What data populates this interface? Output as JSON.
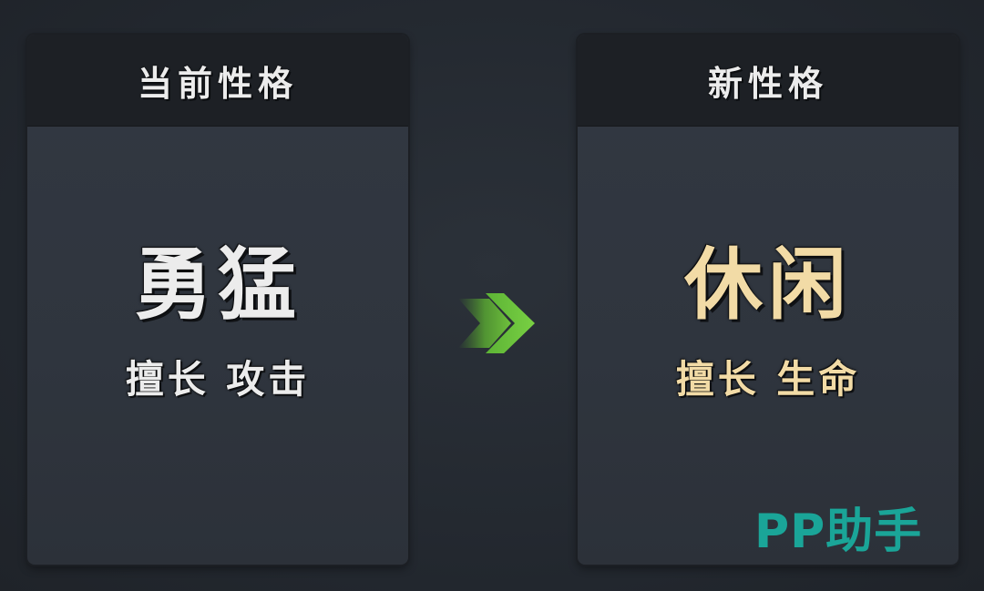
{
  "current": {
    "header": "当前性格",
    "trait": "勇猛",
    "description": "擅长 攻击"
  },
  "next": {
    "header": "新性格",
    "trait": "休闲",
    "description": "擅长 生命"
  },
  "arrow_icon": "double-chevron-right-icon",
  "watermark": "PP助手",
  "colors": {
    "current_text": "#ececec",
    "new_text": "#f2dba6",
    "arrow": "#6fc23c",
    "watermark": "#1aa598"
  }
}
